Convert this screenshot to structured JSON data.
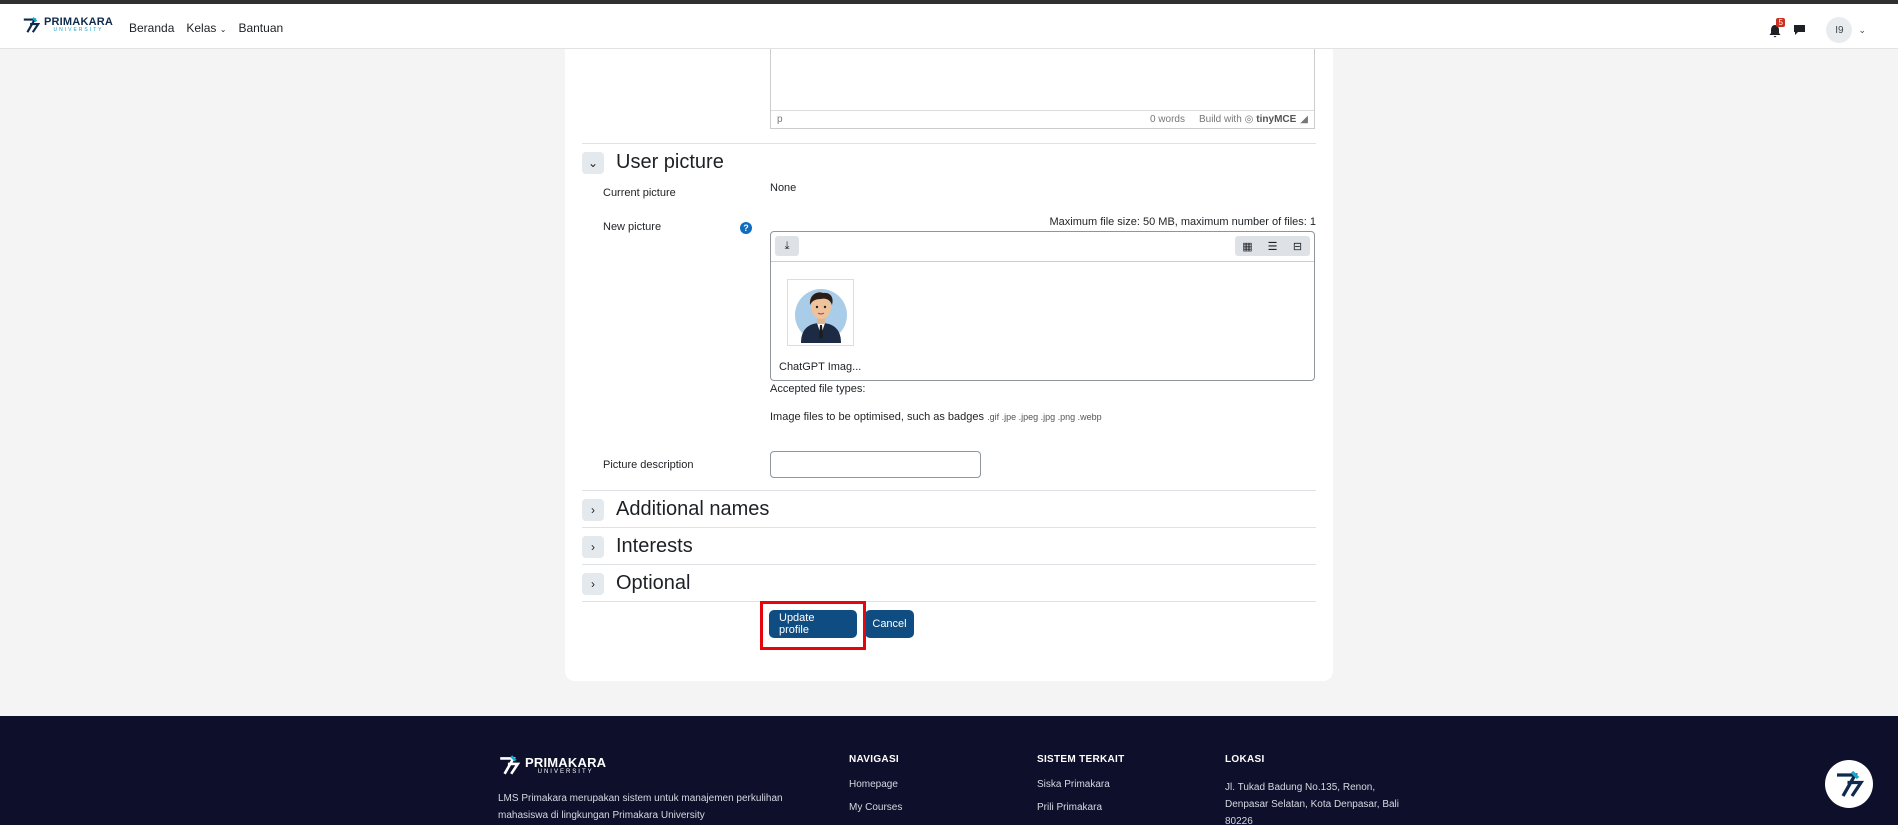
{
  "navbar": {
    "brand_name": "PRIMAKARA",
    "brand_sub": "UNIVERSITY",
    "links": [
      "Beranda",
      "Kelas",
      "Bantuan"
    ],
    "notification_count": "5",
    "user_initials": "I9"
  },
  "editor": {
    "path": "p",
    "word_count": "0 words",
    "built_with": "Build with",
    "tinymce": "tinyMCE"
  },
  "user_picture": {
    "section_title": "User picture",
    "current_picture_label": "Current picture",
    "current_picture_value": "None",
    "new_picture_label": "New picture",
    "help": "?",
    "max_file_info": "Maximum file size: 50 MB, maximum number of files: 1",
    "file_name": "ChatGPT Imag...",
    "accepted_types_label": "Accepted file types:",
    "accepted_types_desc": "Image files to be optimised, such as badges",
    "accepted_types_ext": ".gif .jpe .jpeg .jpg .png .webp",
    "picture_description_label": "Picture description",
    "picture_description_value": ""
  },
  "sections": {
    "additional_names": "Additional names",
    "interests": "Interests",
    "optional": "Optional"
  },
  "actions": {
    "update_label": "Update profile",
    "cancel_label": "Cancel"
  },
  "footer": {
    "brand_name": "PRIMAKARA",
    "brand_sub": "UNIVERSITY",
    "description": "LMS Primakara merupakan sistem untuk manajemen perkulihan mahasiswa di lingkungan Primakara University",
    "nav_heading": "NAVIGASI",
    "nav_items": [
      "Homepage",
      "My Courses"
    ],
    "systems_heading": "SISTEM TERKAIT",
    "systems_items": [
      "Siska Primakara",
      "Prili Primakara"
    ],
    "location_heading": "LOKASI",
    "address": "Jl. Tukad Badung No.135, Renon, Denpasar Selatan, Kota Denpasar, Bali 80226"
  },
  "colors": {
    "primary_button": "#0f4c81",
    "highlight": "#e5050a",
    "footer_bg": "#0d0f2b",
    "brand_accent": "#1aa7c9"
  }
}
